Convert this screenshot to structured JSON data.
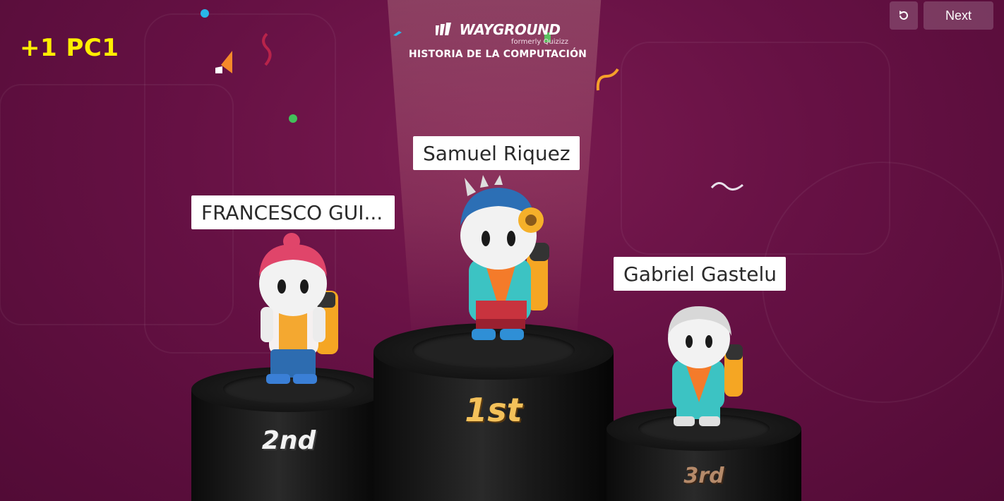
{
  "header": {
    "score_text": "+1 PC1",
    "restart_icon": "restart-icon",
    "next_label": "Next"
  },
  "brand": {
    "logo_text": "WAYGROUND",
    "subtitle": "formerly Quizizz",
    "quiz_title": "HISTORIA DE LA COMPUTACIÓN"
  },
  "podium": {
    "first": {
      "name": "Samuel Riquez",
      "place": "1st"
    },
    "second": {
      "name": "FRANCESCO GUI...",
      "place": "2nd"
    },
    "third": {
      "name": "Gabriel Gastelu",
      "place": "3rd"
    }
  },
  "colors": {
    "background": "#661144",
    "score": "#ffee00",
    "gold": "#f4c15a",
    "silver": "#f2f2f2",
    "bronze": "#b58a6a"
  }
}
